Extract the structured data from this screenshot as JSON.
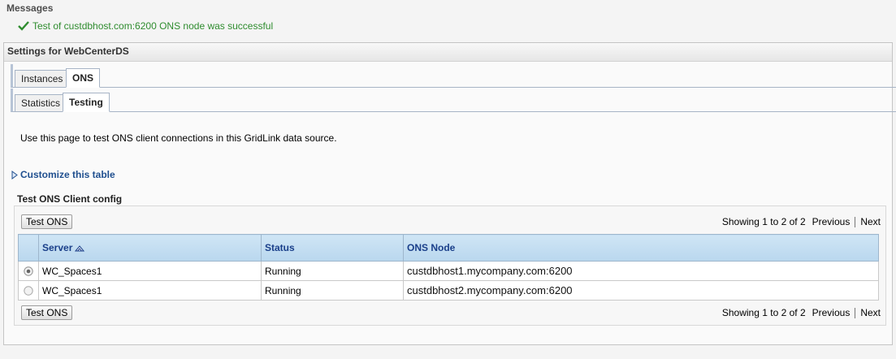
{
  "messages": {
    "title": "Messages",
    "success_text": "Test of custdbhost.com:6200 ONS node was successful"
  },
  "panel": {
    "title": "Settings for WebCenterDS",
    "tabs": [
      {
        "label": "Instances",
        "active": false
      },
      {
        "label": "ONS",
        "active": true
      }
    ],
    "subtabs": [
      {
        "label": "Statistics",
        "active": false
      },
      {
        "label": "Testing",
        "active": true
      }
    ],
    "intro": "Use this page to test ONS client connections in this GridLink data source.",
    "customize_label": "Customize this table",
    "section_title": "Test ONS Client config",
    "test_button_label": "Test ONS",
    "pager": {
      "count_text": "Showing 1 to 2 of 2",
      "previous": "Previous",
      "next": "Next"
    },
    "table": {
      "headers": [
        "Server",
        "Status",
        "ONS Node"
      ],
      "rows": [
        {
          "server": "WC_Spaces1",
          "status": "Running",
          "ons_node": "custdbhost1.mycompany.com:6200",
          "selected": true
        },
        {
          "server": "WC_Spaces1",
          "status": "Running",
          "ons_node": "custdbhost2.mycompany.com:6200",
          "selected": false
        }
      ]
    }
  },
  "colors": {
    "success": "#2f8c2f",
    "link": "#1f4f8f",
    "header_text": "#1a3f8a"
  },
  "icons": {
    "success": "check-icon",
    "customize": "triangle-right-icon",
    "sort": "sort-ascending-icon"
  }
}
